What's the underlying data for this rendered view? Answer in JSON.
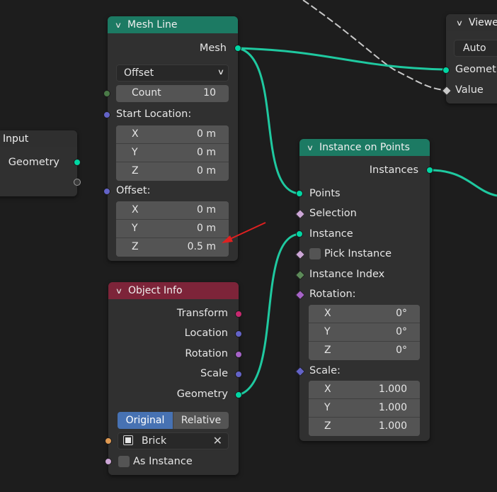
{
  "mesh_line": {
    "title": "Mesh Line",
    "output": "Mesh",
    "mode": "Offset",
    "count_label": "Count",
    "count_value": "10",
    "start_location_label": "Start Location:",
    "start_location": [
      {
        "axis": "X",
        "value": "0 m"
      },
      {
        "axis": "Y",
        "value": "0 m"
      },
      {
        "axis": "Z",
        "value": "0 m"
      }
    ],
    "offset_label": "Offset:",
    "offset": [
      {
        "axis": "X",
        "value": "0 m"
      },
      {
        "axis": "Y",
        "value": "0 m"
      },
      {
        "axis": "Z",
        "value": "0.5 m"
      }
    ]
  },
  "group_input": {
    "title": "Input",
    "output": "Geometry"
  },
  "viewer": {
    "title": "Viewe",
    "mode": "Auto",
    "inputs": [
      "Geometr",
      "Value"
    ]
  },
  "instance_on_points": {
    "title": "Instance on Points",
    "output": "Instances",
    "points": "Points",
    "selection": "Selection",
    "instance": "Instance",
    "pick_instance": "Pick Instance",
    "instance_index": "Instance Index",
    "rotation_label": "Rotation:",
    "rotation": [
      {
        "axis": "X",
        "value": "0°"
      },
      {
        "axis": "Y",
        "value": "0°"
      },
      {
        "axis": "Z",
        "value": "0°"
      }
    ],
    "scale_label": "Scale:",
    "scale": [
      {
        "axis": "X",
        "value": "1.000"
      },
      {
        "axis": "Y",
        "value": "1.000"
      },
      {
        "axis": "Z",
        "value": "1.000"
      }
    ]
  },
  "object_info": {
    "title": "Object Info",
    "outputs": [
      "Transform",
      "Location",
      "Rotation",
      "Scale",
      "Geometry"
    ],
    "toggle": [
      "Original",
      "Relative"
    ],
    "object_name": "Brick",
    "as_instance": "As Instance"
  },
  "colors": {
    "geometry_header": "#1c7a63",
    "input_header": "#7d2439",
    "geometry_socket": "#00d6a3",
    "link": "#1fc9a0",
    "annotation_arrow": "#e02020"
  }
}
